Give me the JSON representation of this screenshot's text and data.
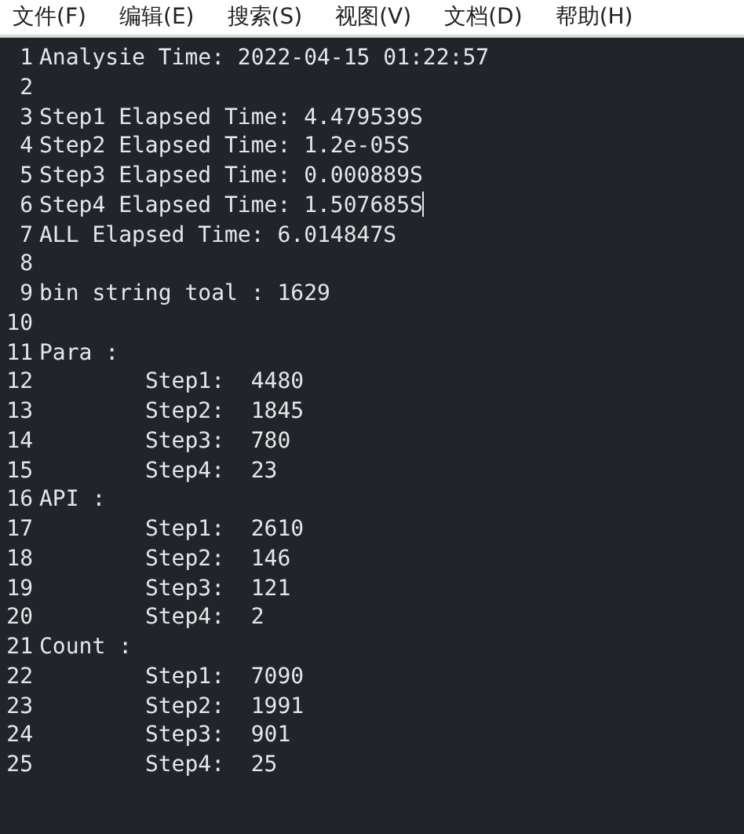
{
  "menu": [
    "文件(F)",
    "编辑(E)",
    "搜索(S)",
    "视图(V)",
    "文档(D)",
    "帮助(H)"
  ],
  "lines": [
    {
      "number": "1",
      "text": "Analysie Time: 2022-04-15 01:22:57",
      "cursor": false
    },
    {
      "number": "2",
      "cursor": false
    },
    {
      "number": "3",
      "text": "Step1 Elapsed Time: 4.479539S",
      "cursor": false
    },
    {
      "number": "4",
      "text": "Step2 Elapsed Time: 1.2e-05S",
      "cursor": false
    },
    {
      "number": "5",
      "text": "Step3 Elapsed Time: 0.000889S",
      "cursor": false
    },
    {
      "number": "6",
      "text": "Step4 Elapsed Time: 1.507685S",
      "cursor": true
    },
    {
      "number": "7",
      "text": "ALL Elapsed Time: 6.014847S",
      "cursor": false
    },
    {
      "number": "8",
      "cursor": false
    },
    {
      "number": "9",
      "text": "bin string toal : 1629",
      "cursor": false
    },
    {
      "number": "10",
      "cursor": false
    },
    {
      "number": "11",
      "text": "Para :",
      "cursor": false
    },
    {
      "number": "12",
      "text": "\tStep1:  4480",
      "cursor": false
    },
    {
      "number": "13",
      "text": "\tStep2:  1845",
      "cursor": false
    },
    {
      "number": "14",
      "text": "\tStep3:  780",
      "cursor": false
    },
    {
      "number": "15",
      "text": "\tStep4:  23",
      "cursor": false
    },
    {
      "number": "16",
      "text": "API :",
      "cursor": false
    },
    {
      "number": "17",
      "text": "\tStep1:  2610",
      "cursor": false
    },
    {
      "number": "18",
      "text": "\tStep2:  146",
      "cursor": false
    },
    {
      "number": "19",
      "text": "\tStep3:  121",
      "cursor": false
    },
    {
      "number": "20",
      "text": "\tStep4:  2",
      "cursor": false
    },
    {
      "number": "21",
      "text": "Count :",
      "cursor": false
    },
    {
      "number": "22",
      "text": "\tStep1:  7090",
      "cursor": false
    },
    {
      "number": "23",
      "text": "\tStep2:  1991",
      "cursor": false
    },
    {
      "number": "24",
      "text": "\tStep3:  901",
      "cursor": false
    },
    {
      "number": "25",
      "text": "\tStep4:  25",
      "cursor": false
    }
  ]
}
